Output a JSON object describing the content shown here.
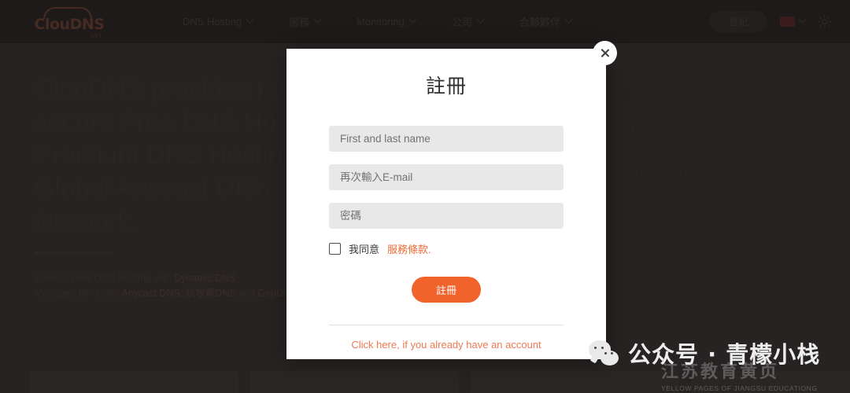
{
  "nav": {
    "logo": {
      "name": "ClouDNS",
      "tld": "NET"
    },
    "items": [
      {
        "label": "DNS Hosting",
        "has_chevron": true
      },
      {
        "label": "服務",
        "has_chevron": true
      },
      {
        "label": "Monitoring",
        "has_chevron": true
      },
      {
        "label": "公司",
        "has_chevron": true
      },
      {
        "label": "合夥夥伴",
        "has_chevron": true
      }
    ],
    "register_label": "登記",
    "language_flag": "china-flag-icon",
    "theme_icon": "sun-icon"
  },
  "hero": {
    "title": "ClouDNS provides fast and secure Free DNS Hosting, Premium DNS Hosting and Global Anycast DNS Network.",
    "sub_line1_pre": "Forever Free DNS Hosting with ",
    "sub_line1_link": "Dynamic DNS",
    "sub_line2_pre": "Managed DNS with ",
    "sub_line2_link1": "Anycast DNS",
    "sub_line2_mid": ", ",
    "sub_line2_link2": "抗攻擊DNS",
    "sub_line2_post": " and ",
    "sub_line2_link3": "GeoDNS"
  },
  "modal": {
    "title": "註冊",
    "fields": [
      {
        "name": "full-name",
        "placeholder": "First and last name",
        "value": ""
      },
      {
        "name": "email-confirm",
        "placeholder": "再次輸入E-mail",
        "value": ""
      },
      {
        "name": "password",
        "placeholder": "密碼",
        "value": ""
      }
    ],
    "terms_prefix": "我同意",
    "terms_link": "服務條款.",
    "terms_checked": false,
    "submit_label": "註冊",
    "login_link": "Click here, if you already have an account",
    "close_icon": "close-icon"
  },
  "watermark": {
    "wechat_icon": "wechat-icon",
    "text": "公众号 · 青檬小栈",
    "secondary_cn": "江苏教育黄页",
    "secondary_en": "YELLOW PAGES OF JIANGSU EDUCATIONG"
  },
  "colors": {
    "accent_orange": "#f2622b",
    "link_orange": "#ef7a52",
    "nav_bg": "#221f1f",
    "page_bg": "#3a3535",
    "modal_bg": "#ffffff",
    "field_bg": "#e8e8e8"
  }
}
